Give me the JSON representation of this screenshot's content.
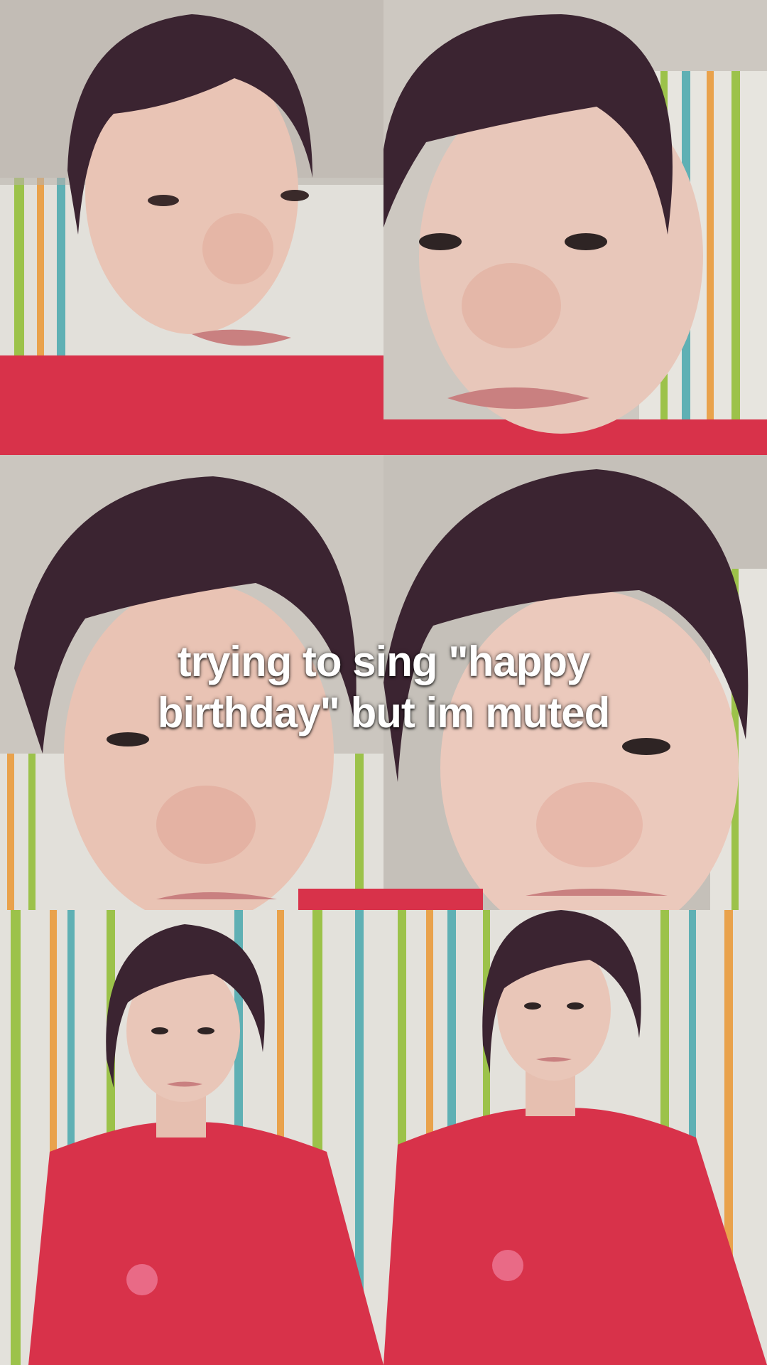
{
  "caption": {
    "line1": "trying to sing \"happy",
    "line2": "birthday\" but im muted"
  },
  "tiles": [
    {
      "label": "participant-video-1"
    },
    {
      "label": "participant-video-2"
    },
    {
      "label": "participant-video-3"
    },
    {
      "label": "participant-video-4"
    },
    {
      "label": "participant-video-5"
    },
    {
      "label": "participant-video-6"
    }
  ],
  "colors": {
    "shirt": "#d8324a",
    "hair": "#3b2431",
    "skin": "#e9c4b5",
    "curtain_bg": "#e4e2dc",
    "stripe_green": "#9cc24a",
    "stripe_orange": "#e9a24c",
    "stripe_teal": "#5fb0b4",
    "caption_text": "#ffffff"
  }
}
